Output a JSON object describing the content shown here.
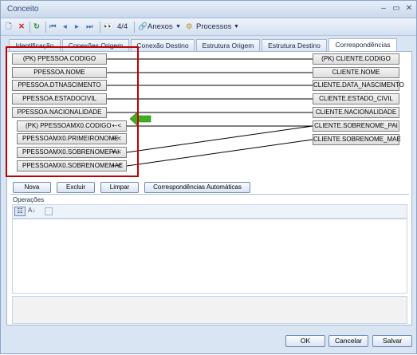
{
  "window": {
    "title": "Conceito"
  },
  "toolbar": {
    "record_counter": "4/4",
    "attachments_label": "Anexos",
    "processes_label": "Processos"
  },
  "tabs": [
    {
      "label": "Identificação"
    },
    {
      "label": "Conexões Origem"
    },
    {
      "label": "Conexão Destino"
    },
    {
      "label": "Estrutura Origem"
    },
    {
      "label": "Estrutura Destino"
    },
    {
      "label": "Correspondências"
    }
  ],
  "source_fields": [
    {
      "label": "(PK)  PPESSOA.CODIGO"
    },
    {
      "label": "PPESSOA.NOME"
    },
    {
      "label": "PPESSOA.DTNASCIMENTO"
    },
    {
      "label": "PPESSOA.ESTADOCIVIL"
    },
    {
      "label": "PPESSOA.NACIONALIDADE"
    },
    {
      "label": "(PK)  PPESSOAMX0.CODIGO"
    },
    {
      "label": "PPESSOAMX0.PRIMEIRONOME"
    },
    {
      "label": "PPESSOAMX0.SOBRENOMEPAI"
    },
    {
      "label": "PPESSOAMX0.SOBRENOMEMAE"
    }
  ],
  "target_fields": [
    {
      "label": "(PK)  CLIENTE.CODIGO"
    },
    {
      "label": "CLIENTE.NOME"
    },
    {
      "label": "CLIENTE.DATA_NASCIMENTO"
    },
    {
      "label": "CLIENTE.ESTADO_CIVIL"
    },
    {
      "label": "CLIENTE.NACIONALIDADE"
    },
    {
      "label": "CLIENTE.SOBRENOME_PAI"
    },
    {
      "label": "CLIENTE.SOBRENOME_MAE"
    }
  ],
  "link_glyph": "⇠<",
  "actions": {
    "new": "Nova",
    "delete": "Excluir",
    "clear": "Limpar",
    "auto": "Correspondências Automáticas"
  },
  "operations": {
    "label": "Operações"
  },
  "footer": {
    "ok": "OK",
    "cancel": "Cancelar",
    "save": "Salvar"
  },
  "colors": {
    "highlight_box": "#c00000",
    "arrow_green": "#3fae1f"
  }
}
